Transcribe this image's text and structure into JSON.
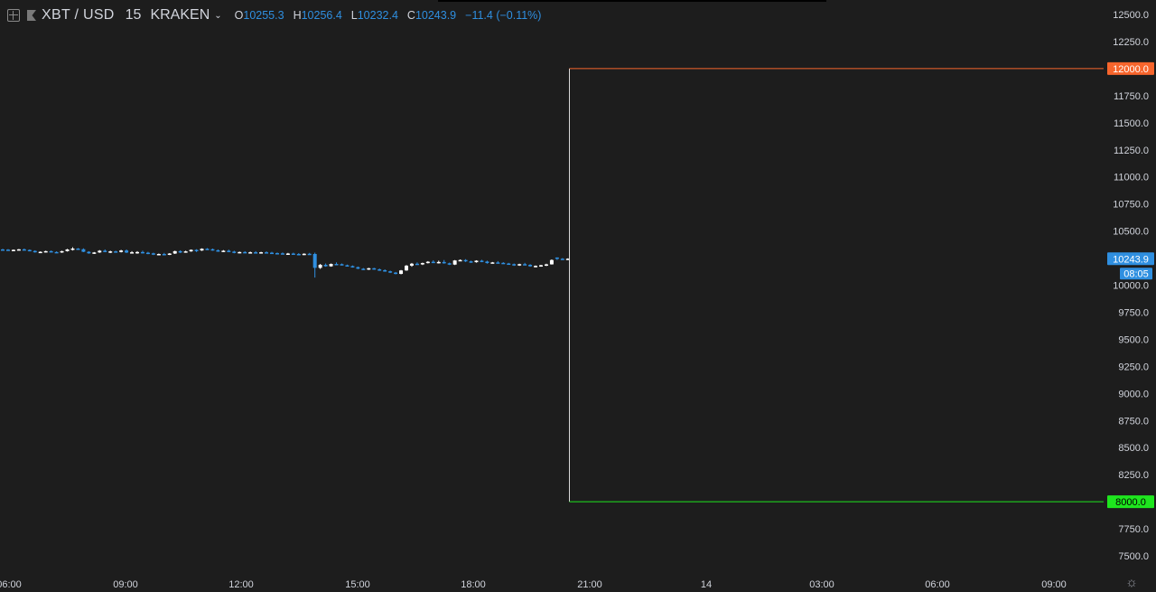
{
  "legend": {
    "symbol": "XBT / USD",
    "interval": "15",
    "exchange": "KRAKEN",
    "open_label": "O",
    "open": "10255.3",
    "high_label": "H",
    "high": "10256.4",
    "low_label": "L",
    "low": "10232.4",
    "close_label": "C",
    "close": "10243.9",
    "change": "−11.4 (−0.11%)"
  },
  "chart_data": {
    "type": "candlestick",
    "y_ticks": [
      "12500.0",
      "12250.0",
      "12000.0",
      "11750.0",
      "11500.0",
      "11250.0",
      "11000.0",
      "10750.0",
      "10500.0",
      "10250.0",
      "10000.0",
      "9750.0",
      "9500.0",
      "9250.0",
      "9000.0",
      "8750.0",
      "8500.0",
      "8250.0",
      "8000.0",
      "7750.0",
      "7500.0"
    ],
    "y_values": [
      12500,
      12250,
      12000,
      11750,
      11500,
      11250,
      11000,
      10750,
      10500,
      10250,
      10000,
      9750,
      9500,
      9250,
      9000,
      8750,
      8500,
      8250,
      8000,
      7750,
      7500
    ],
    "x_ticks": [
      "06:00",
      "09:00",
      "12:00",
      "15:00",
      "18:00",
      "21:00",
      "14",
      "03:00",
      "06:00",
      "09:00"
    ],
    "ylim": [
      7420,
      12560
    ],
    "price_labels": {
      "upper": {
        "text": "12000.0",
        "value": 12000,
        "color": "#f7652c"
      },
      "lower": {
        "text": "8000.0",
        "value": 8000,
        "color": "#1ee61e"
      },
      "last": {
        "text": "10243.9",
        "value": 10243.9,
        "color": "#2f8fe0"
      },
      "countdown": {
        "text": "08:05",
        "color": "#2f8fe0"
      }
    },
    "colors": {
      "up": "#ffffff",
      "down": "#2f8fe0",
      "upper_line": "#f7652c",
      "lower_line": "#1ee61e",
      "vertical_line": "#d9d9d9",
      "axis_text": "#d1d4dc"
    },
    "candles": [
      [
        10330,
        10336,
        10325,
        10328
      ],
      [
        10328,
        10333,
        10318,
        10322
      ],
      [
        10322,
        10330,
        10316,
        10326
      ],
      [
        10326,
        10334,
        10320,
        10331
      ],
      [
        10331,
        10338,
        10322,
        10325
      ],
      [
        10325,
        10330,
        10312,
        10316
      ],
      [
        10316,
        10322,
        10300,
        10304
      ],
      [
        10304,
        10312,
        10298,
        10308
      ],
      [
        10308,
        10318,
        10302,
        10314
      ],
      [
        10314,
        10320,
        10304,
        10306
      ],
      [
        10306,
        10312,
        10298,
        10302
      ],
      [
        10302,
        10318,
        10298,
        10314
      ],
      [
        10314,
        10335,
        10310,
        10330
      ],
      [
        10330,
        10350,
        10320,
        10338
      ],
      [
        10338,
        10342,
        10326,
        10332
      ],
      [
        10332,
        10340,
        10305,
        10308
      ],
      [
        10308,
        10314,
        10290,
        10294
      ],
      [
        10294,
        10306,
        10288,
        10302
      ],
      [
        10302,
        10324,
        10298,
        10318
      ],
      [
        10318,
        10330,
        10304,
        10310
      ],
      [
        10310,
        10318,
        10296,
        10312
      ],
      [
        10312,
        10318,
        10302,
        10306
      ],
      [
        10306,
        10326,
        10302,
        10320
      ],
      [
        10320,
        10330,
        10296,
        10301
      ],
      [
        10301,
        10314,
        10296,
        10304
      ],
      [
        10304,
        10314,
        10290,
        10306
      ],
      [
        10306,
        10318,
        10292,
        10300
      ],
      [
        10300,
        10308,
        10286,
        10294
      ],
      [
        10294,
        10300,
        10278,
        10282
      ],
      [
        10282,
        10292,
        10276,
        10288
      ],
      [
        10288,
        10298,
        10276,
        10280
      ],
      [
        10280,
        10296,
        10278,
        10292
      ],
      [
        10292,
        10318,
        10288,
        10314
      ],
      [
        10314,
        10322,
        10296,
        10304
      ],
      [
        10304,
        10318,
        10300,
        10312
      ],
      [
        10312,
        10330,
        10308,
        10326
      ],
      [
        10326,
        10332,
        10306,
        10320
      ],
      [
        10320,
        10340,
        10316,
        10336
      ],
      [
        10336,
        10342,
        10326,
        10332
      ],
      [
        10332,
        10338,
        10318,
        10322
      ],
      [
        10322,
        10330,
        10308,
        10312
      ],
      [
        10312,
        10324,
        10306,
        10318
      ],
      [
        10318,
        10328,
        10304,
        10310
      ],
      [
        10310,
        10318,
        10294,
        10298
      ],
      [
        10298,
        10310,
        10294,
        10306
      ],
      [
        10306,
        10314,
        10296,
        10300
      ],
      [
        10300,
        10310,
        10294,
        10304
      ],
      [
        10304,
        10314,
        10296,
        10300
      ],
      [
        10300,
        10308,
        10292,
        10304
      ],
      [
        10304,
        10312,
        10296,
        10300
      ],
      [
        10300,
        10308,
        10290,
        10296
      ],
      [
        10296,
        10302,
        10288,
        10294
      ],
      [
        10294,
        10302,
        10286,
        10290
      ],
      [
        10290,
        10298,
        10282,
        10292
      ],
      [
        10292,
        10300,
        10284,
        10288
      ],
      [
        10288,
        10296,
        10280,
        10284
      ],
      [
        10284,
        10294,
        10278,
        10290
      ],
      [
        10290,
        10298,
        10284,
        10288
      ],
      [
        10288,
        10300,
        10070,
        10160
      ],
      [
        10160,
        10196,
        10150,
        10188
      ],
      [
        10188,
        10200,
        10170,
        10174
      ],
      [
        10174,
        10200,
        10170,
        10196
      ],
      [
        10196,
        10210,
        10190,
        10194
      ],
      [
        10194,
        10200,
        10182,
        10184
      ],
      [
        10184,
        10190,
        10172,
        10176
      ],
      [
        10176,
        10182,
        10162,
        10166
      ],
      [
        10166,
        10172,
        10148,
        10152
      ],
      [
        10152,
        10158,
        10140,
        10144
      ],
      [
        10144,
        10160,
        10140,
        10156
      ],
      [
        10156,
        10160,
        10142,
        10146
      ],
      [
        10146,
        10154,
        10132,
        10138
      ],
      [
        10138,
        10146,
        10124,
        10128
      ],
      [
        10128,
        10134,
        10112,
        10116
      ],
      [
        10116,
        10122,
        10100,
        10104
      ],
      [
        10104,
        10140,
        10100,
        10136
      ],
      [
        10136,
        10186,
        10132,
        10180
      ],
      [
        10180,
        10205,
        10170,
        10198
      ],
      [
        10198,
        10210,
        10190,
        10192
      ],
      [
        10192,
        10208,
        10186,
        10204
      ],
      [
        10204,
        10222,
        10200,
        10216
      ],
      [
        10216,
        10230,
        10204,
        10208
      ],
      [
        10208,
        10226,
        10200,
        10214
      ],
      [
        10214,
        10232,
        10198,
        10202
      ],
      [
        10202,
        10208,
        10186,
        10190
      ],
      [
        10190,
        10232,
        10186,
        10228
      ],
      [
        10228,
        10238,
        10224,
        10232
      ],
      [
        10232,
        10240,
        10214,
        10220
      ],
      [
        10220,
        10226,
        10206,
        10212
      ],
      [
        10212,
        10230,
        10208,
        10226
      ],
      [
        10226,
        10234,
        10212,
        10218
      ],
      [
        10218,
        10226,
        10198,
        10204
      ],
      [
        10204,
        10214,
        10200,
        10210
      ],
      [
        10210,
        10222,
        10204,
        10206
      ],
      [
        10206,
        10212,
        10196,
        10200
      ],
      [
        10200,
        10206,
        10190,
        10194
      ],
      [
        10194,
        10200,
        10178,
        10182
      ],
      [
        10182,
        10198,
        10178,
        10194
      ],
      [
        10194,
        10206,
        10184,
        10188
      ],
      [
        10188,
        10194,
        10170,
        10174
      ],
      [
        10174,
        10182,
        10164,
        10178
      ],
      [
        10178,
        10188,
        10170,
        10184
      ],
      [
        10184,
        10198,
        10176,
        10192
      ],
      [
        10192,
        10238,
        10190,
        10232
      ],
      [
        10255.3,
        10256.4,
        10232.4,
        10243.9
      ],
      [
        10244,
        10250,
        10236,
        10240
      ],
      [
        10240,
        10248,
        10234,
        10244
      ]
    ]
  }
}
